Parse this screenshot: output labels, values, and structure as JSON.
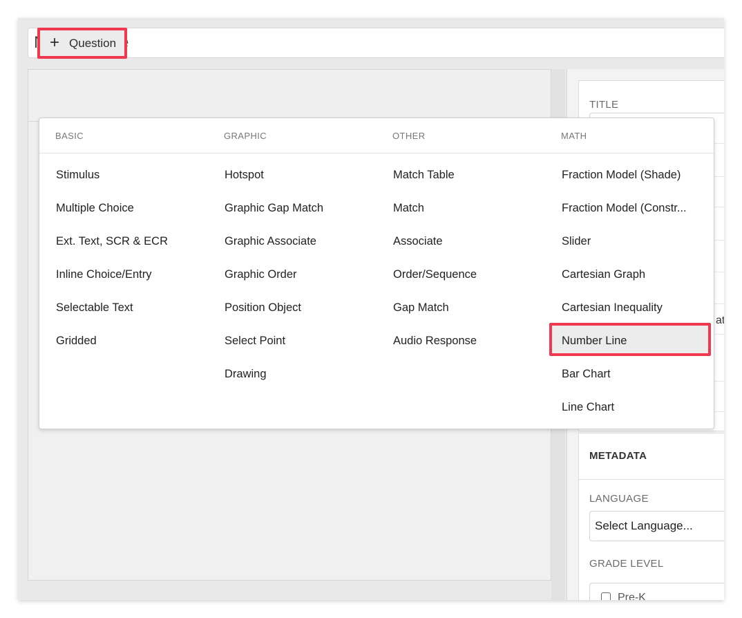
{
  "title_field": {
    "value": "Number Line"
  },
  "toolbar": {
    "add_question_label": "Question"
  },
  "dropdown": {
    "columns": [
      {
        "header": "BASIC",
        "items": [
          "Stimulus",
          "Multiple Choice",
          "Ext. Text, SCR & ECR",
          "Inline Choice/Entry",
          "Selectable Text",
          "Gridded"
        ]
      },
      {
        "header": "GRAPHIC",
        "items": [
          "Hotspot",
          "Graphic Gap Match",
          "Graphic Associate",
          "Graphic Order",
          "Position Object",
          "Select Point",
          "Drawing"
        ]
      },
      {
        "header": "OTHER",
        "items": [
          "Match Table",
          "Match",
          "Associate",
          "Order/Sequence",
          "Gap Match",
          "Audio Response"
        ]
      },
      {
        "header": "MATH",
        "items": [
          "Fraction Model (Shade)",
          "Fraction Model (Constr...",
          "Slider",
          "Cartesian Graph",
          "Cartesian Inequality",
          "Number Line",
          "Bar Chart",
          "Line Chart"
        ]
      }
    ],
    "selected_item": "Number Line"
  },
  "right_panel": {
    "title_label": "TITLE",
    "partial_text": "at",
    "metadata": {
      "heading": "METADATA",
      "language_label": "LANGUAGE",
      "language_value": "Select Language...",
      "grade_level_label": "GRADE LEVEL",
      "grade_first_option": "Pre-K"
    }
  },
  "colors": {
    "highlight_border": "#f0384f",
    "frame_bg": "#e9e9e9"
  }
}
